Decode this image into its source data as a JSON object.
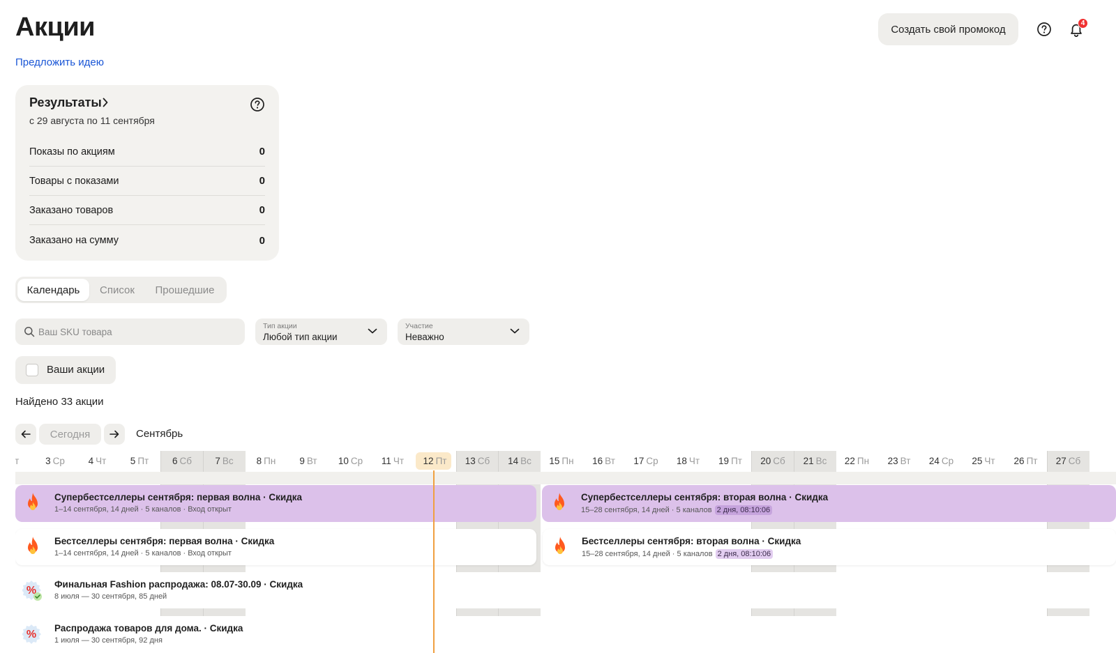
{
  "header": {
    "title": "Акции",
    "idea_link": "Предложить идею",
    "promo_button": "Создать свой промокод",
    "notifications_count": "4"
  },
  "results": {
    "title": "Результаты",
    "period": "с 29 августа по 11 сентября",
    "rows": [
      {
        "label": "Показы по акциям",
        "value": "0"
      },
      {
        "label": "Товары с показами",
        "value": "0"
      },
      {
        "label": "Заказано товаров",
        "value": "0"
      },
      {
        "label": "Заказано на сумму",
        "value": "0"
      }
    ]
  },
  "tabs": [
    {
      "label": "Календарь",
      "active": true
    },
    {
      "label": "Список",
      "active": false
    },
    {
      "label": "Прошедшие",
      "active": false
    }
  ],
  "filters": {
    "search_placeholder": "Ваш SKU товара",
    "type": {
      "label": "Тип акции",
      "value": "Любой тип акции"
    },
    "participation": {
      "label": "Участие",
      "value": "Неважно"
    },
    "yours_checkbox": "Ваши акции"
  },
  "found_text": "Найдено 33 акции",
  "calendar_nav": {
    "today_label": "Сегодня",
    "month": "Сентябрь"
  },
  "days": [
    {
      "num": "",
      "dow": "Вт",
      "weekend": false
    },
    {
      "num": "3",
      "dow": "Ср",
      "weekend": false
    },
    {
      "num": "4",
      "dow": "Чт",
      "weekend": false
    },
    {
      "num": "5",
      "dow": "Пт",
      "weekend": false
    },
    {
      "num": "6",
      "dow": "Сб",
      "weekend": true
    },
    {
      "num": "7",
      "dow": "Вс",
      "weekend": true
    },
    {
      "num": "8",
      "dow": "Пн",
      "weekend": false
    },
    {
      "num": "9",
      "dow": "Вт",
      "weekend": false
    },
    {
      "num": "10",
      "dow": "Ср",
      "weekend": false
    },
    {
      "num": "11",
      "dow": "Чт",
      "weekend": false
    },
    {
      "num": "12",
      "dow": "Пт",
      "weekend": false,
      "today": true
    },
    {
      "num": "13",
      "dow": "Сб",
      "weekend": true
    },
    {
      "num": "14",
      "dow": "Вс",
      "weekend": true
    },
    {
      "num": "15",
      "dow": "Пн",
      "weekend": false
    },
    {
      "num": "16",
      "dow": "Вт",
      "weekend": false
    },
    {
      "num": "17",
      "dow": "Ср",
      "weekend": false
    },
    {
      "num": "18",
      "dow": "Чт",
      "weekend": false
    },
    {
      "num": "19",
      "dow": "Пт",
      "weekend": false
    },
    {
      "num": "20",
      "dow": "Сб",
      "weekend": true
    },
    {
      "num": "21",
      "dow": "Вс",
      "weekend": true
    },
    {
      "num": "22",
      "dow": "Пн",
      "weekend": false
    },
    {
      "num": "23",
      "dow": "Вт",
      "weekend": false
    },
    {
      "num": "24",
      "dow": "Ср",
      "weekend": false
    },
    {
      "num": "25",
      "dow": "Чт",
      "weekend": false
    },
    {
      "num": "26",
      "dow": "Пт",
      "weekend": false
    },
    {
      "num": "27",
      "dow": "Сб",
      "weekend": true
    }
  ],
  "events": [
    {
      "title": "Супербестселлеры сентября: первая волна · Скидка",
      "sub": "1–14 сентября, 14 дней · 5 каналов · Вход открыт",
      "timer": "",
      "icon": "fire-icon",
      "style": "purple"
    },
    {
      "title": "Супербестселлеры сентября: вторая волна · Скидка",
      "sub": "15–28 сентября, 14 дней · 5 каналов",
      "timer": "2 дня, 08:10:06",
      "icon": "fire-icon",
      "style": "purple"
    },
    {
      "title": "Бестселлеры сентября: первая волна · Скидка",
      "sub": "1–14 сентября, 14 дней · 5 каналов · Вход открыт",
      "timer": "",
      "icon": "fire-icon",
      "style": "white"
    },
    {
      "title": "Бестселлеры сентября: вторая волна · Скидка",
      "sub": "15–28 сентября, 14 дней · 5 каналов",
      "timer": "2 дня, 08:10:06",
      "icon": "fire-icon",
      "style": "white"
    },
    {
      "title": "Финальная Fashion распродажа: 08.07-30.09 · Скидка",
      "sub": "8 июля — 30 сентября, 85 дней",
      "timer": "",
      "icon": "discount-check-icon",
      "style": "flat"
    },
    {
      "title": "Распродажа товаров для дома. · Скидка",
      "sub": "1 июля — 30 сентября, 92 дня",
      "timer": "",
      "icon": "discount-icon",
      "style": "flat"
    }
  ],
  "colors": {
    "accent_link": "#1a56d6",
    "event_purple": "#dcc1ea",
    "today_highlight": "#fbe9c9",
    "today_line": "#f0a040",
    "badge_red": "#f03030"
  }
}
